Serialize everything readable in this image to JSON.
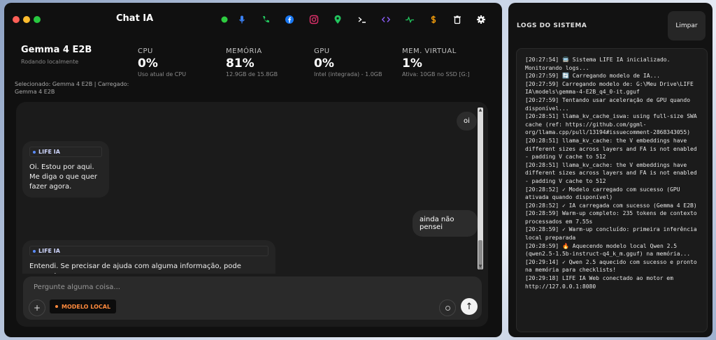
{
  "window": {
    "title": "Chat IA"
  },
  "traffic_lights": [
    {
      "name": "close",
      "color": "#ff5f57"
    },
    {
      "name": "minimize",
      "color": "#febc2e"
    },
    {
      "name": "maximize",
      "color": "#28c840"
    }
  ],
  "toolbar": [
    {
      "name": "status-dot-icon",
      "color": "#2ecc40"
    },
    {
      "name": "microphone-icon",
      "color": "#3b82f6"
    },
    {
      "name": "phone-icon",
      "color": "#22c55e"
    },
    {
      "name": "facebook-icon",
      "color": "#1877f2"
    },
    {
      "name": "instagram-icon",
      "color": "#e1306c"
    },
    {
      "name": "map-pin-icon",
      "color": "#22c55e"
    },
    {
      "name": "terminal-icon",
      "color": "#ffffff"
    },
    {
      "name": "code-icon",
      "color": "#8b5cf6"
    },
    {
      "name": "activity-icon",
      "color": "#22c55e"
    },
    {
      "name": "currency-icon",
      "color": "#f59e0b"
    },
    {
      "name": "trash-icon",
      "color": "#ffffff"
    },
    {
      "name": "gear-icon",
      "color": "#ffffff"
    }
  ],
  "model": {
    "name": "Gemma 4 E2B",
    "subtitle": "Rodando localmente",
    "selected_info": "Selecionado: Gemma 4 E2B | Carregado: Gemma 4 E2B"
  },
  "stats": {
    "cpu": {
      "label": "CPU",
      "value": "0%",
      "sub": "Uso atual de CPU"
    },
    "memory": {
      "label": "MEMÓRIA",
      "value": "81%",
      "sub": "12.9GB de 15.8GB"
    },
    "gpu": {
      "label": "GPU",
      "value": "0%",
      "sub": "Intel (integrada) - 1.0GB"
    },
    "virtual": {
      "label": "MEM. VIRTUAL",
      "value": "1%",
      "sub": "Ativa: 10GB no SSD [G:]"
    }
  },
  "messages": {
    "user_1": "oi",
    "bot_1_author": "LIFE IA",
    "bot_1_text": "Oi. Estou por aqui. Me diga o que quer fazer agora.",
    "user_2": "ainda não pensei",
    "bot_2_author": "LIFE IA",
    "bot_2_text": "Entendi. Se precisar de ajuda com alguma informação, pode perguntar a"
  },
  "composer": {
    "placeholder": "Pergunte alguma coisa...",
    "plus_label": "+",
    "model_chip": "MODELO LOCAL",
    "send_label": "↑"
  },
  "logs": {
    "title": "LOGS DO SISTEMA",
    "clear_label": "Limpar",
    "lines": [
      "[20:27:54] 🚍 Sistema LIFE IA inicializado. Monitorando logs...",
      "[20:27:59] 🔄 Carregando modelo de IA...",
      "[20:27:59] Carregando modelo de: G:\\Meu Drive\\LIFE IA\\models\\gemma-4-E2B_q4_0-it.gguf",
      "[20:27:59] Tentando usar aceleração de GPU quando disponível...",
      "[20:28:51] llama_kv_cache_iswa: using full-size SWA cache (ref: https://github.com/ggml-org/llama.cpp/pull/13194#issuecomment-2868343055)",
      "[20:28:51] llama_kv_cache: the V embeddings have different sizes across layers and FA is not enabled - padding V cache to 512",
      "[20:28:51] llama_kv_cache: the V embeddings have different sizes across layers and FA is not enabled - padding V cache to 512",
      "[20:28:52] ✓ Modelo carregado com sucesso (GPU ativada quando disponível)",
      "[20:28:52] ✓ IA carregada com sucesso (Gemma 4 E2B)",
      "[20:28:59] Warm-up completo: 235 tokens de contexto processados em 7.55s",
      "[20:28:59] ✓ Warm-up concluído: primeira inferência local preparada",
      "[20:28:59] 🔥 Aquecendo modelo local Qwen 2.5 (qwen2.5-1.5b-instruct-q4_k_m.gguf) na memória...",
      "[20:29:14] ✓ Qwen 2.5 aquecido com sucesso e pronto na memória para checklists!",
      "[20:29:18] LIFE IA Web conectado ao motor em http://127.0.0.1:8080"
    ]
  }
}
